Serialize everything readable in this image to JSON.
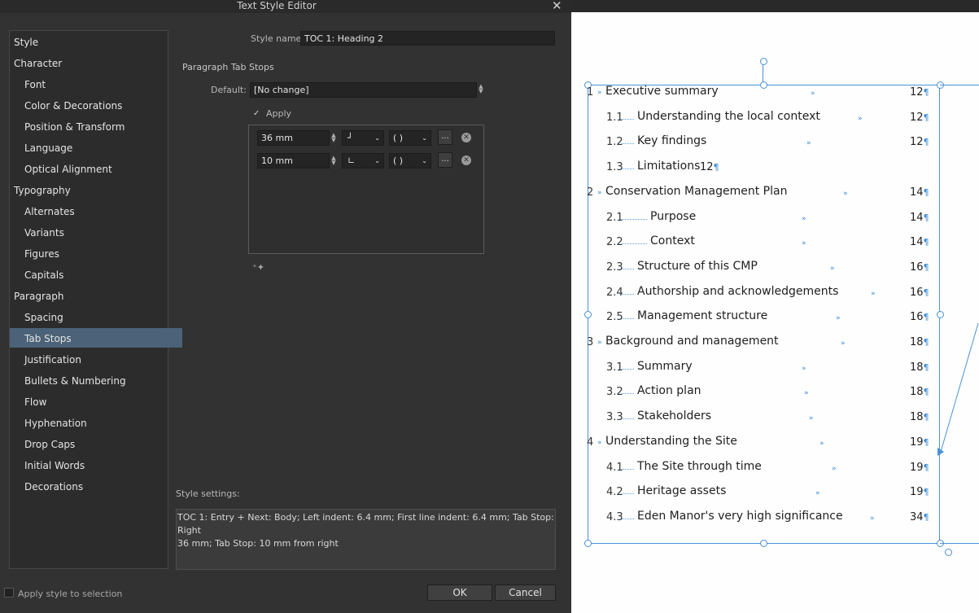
{
  "dialog": {
    "title": "Text Style Editor",
    "close_icon": "close-icon"
  },
  "sidebar": {
    "items": [
      {
        "label": "Style",
        "level": 1
      },
      {
        "label": "Character",
        "level": 1
      },
      {
        "label": "Font",
        "level": 2
      },
      {
        "label": "Color & Decorations",
        "level": 2
      },
      {
        "label": "Position & Transform",
        "level": 2
      },
      {
        "label": "Language",
        "level": 2
      },
      {
        "label": "Optical Alignment",
        "level": 2
      },
      {
        "label": "Typography",
        "level": 1
      },
      {
        "label": "Alternates",
        "level": 2
      },
      {
        "label": "Variants",
        "level": 2
      },
      {
        "label": "Figures",
        "level": 2
      },
      {
        "label": "Capitals",
        "level": 2
      },
      {
        "label": "Paragraph",
        "level": 1
      },
      {
        "label": "Spacing",
        "level": 2
      },
      {
        "label": "Tab Stops",
        "level": 2,
        "selected": true
      },
      {
        "label": "Justification",
        "level": 2
      },
      {
        "label": "Bullets & Numbering",
        "level": 2
      },
      {
        "label": "Flow",
        "level": 2
      },
      {
        "label": "Hyphenation",
        "level": 2
      },
      {
        "label": "Drop Caps",
        "level": 2
      },
      {
        "label": "Initial Words",
        "level": 2
      },
      {
        "label": "Decorations",
        "level": 2
      }
    ]
  },
  "style_name": {
    "label": "Style name:",
    "value": "TOC 1: Heading 2"
  },
  "tab_stops": {
    "section_title": "Paragraph Tab Stops",
    "default_label": "Default:",
    "default_value": "[No change]",
    "apply_label": "Apply",
    "apply_checked": true,
    "rows": [
      {
        "position": "36 mm",
        "alignment_glyph": "┘",
        "leader_glyph": "( )",
        "more_label": "..."
      },
      {
        "position": "10 mm",
        "alignment_glyph": "∟",
        "leader_glyph": "( )",
        "more_label": "..."
      }
    ]
  },
  "style_settings": {
    "label": "Style settings:",
    "line1": "TOC 1: Entry + Next: Body; Left indent: 6.4 mm; First line indent: 6.4 mm; Tab Stop: Right",
    "line2": "36 mm; Tab Stop: 10 mm from right"
  },
  "footer": {
    "apply_selection_label": "Apply style to selection",
    "ok_label": "OK",
    "cancel_label": "Cancel"
  },
  "document": {
    "entries": [
      {
        "num": "1",
        "title": "Executive summary",
        "page": "12",
        "level": 1
      },
      {
        "num": "1.1",
        "title": "Understanding the local context",
        "page": "12",
        "level": 2
      },
      {
        "num": "1.2",
        "title": "Key findings",
        "page": "12",
        "level": 2
      },
      {
        "num": "1.3",
        "title": "Limitations",
        "page": "12",
        "level": 2
      },
      {
        "num": "2",
        "title": "Conservation Management Plan",
        "page": "14",
        "level": 1
      },
      {
        "num": "2.1",
        "title": "Purpose",
        "page": "14",
        "level": 2
      },
      {
        "num": "2.2",
        "title": "Context",
        "page": "14",
        "level": 2
      },
      {
        "num": "2.3",
        "title": "Structure of this CMP",
        "page": "16",
        "level": 2
      },
      {
        "num": "2.4",
        "title": "Authorship and acknowledgements",
        "page": "16",
        "level": 2
      },
      {
        "num": "2.5",
        "title": "Management structure",
        "page": "16",
        "level": 2
      },
      {
        "num": "3",
        "title": "Background and management",
        "page": "18",
        "level": 1
      },
      {
        "num": "3.1",
        "title": "Summary",
        "page": "18",
        "level": 2
      },
      {
        "num": "3.2",
        "title": "Action plan",
        "page": "18",
        "level": 2
      },
      {
        "num": "3.3",
        "title": "Stakeholders",
        "page": "18",
        "level": 2
      },
      {
        "num": "4",
        "title": "Understanding the Site",
        "page": "19",
        "level": 1
      },
      {
        "num": "4.1",
        "title": "The Site through time",
        "page": "19",
        "level": 2
      },
      {
        "num": "4.2",
        "title": "Heritage assets",
        "page": "19",
        "level": 2
      },
      {
        "num": "4.3",
        "title": "Eden Manor's very high significance",
        "page": "34",
        "level": 2
      }
    ],
    "pilcrow": "¶",
    "tab_glyph": "»"
  }
}
